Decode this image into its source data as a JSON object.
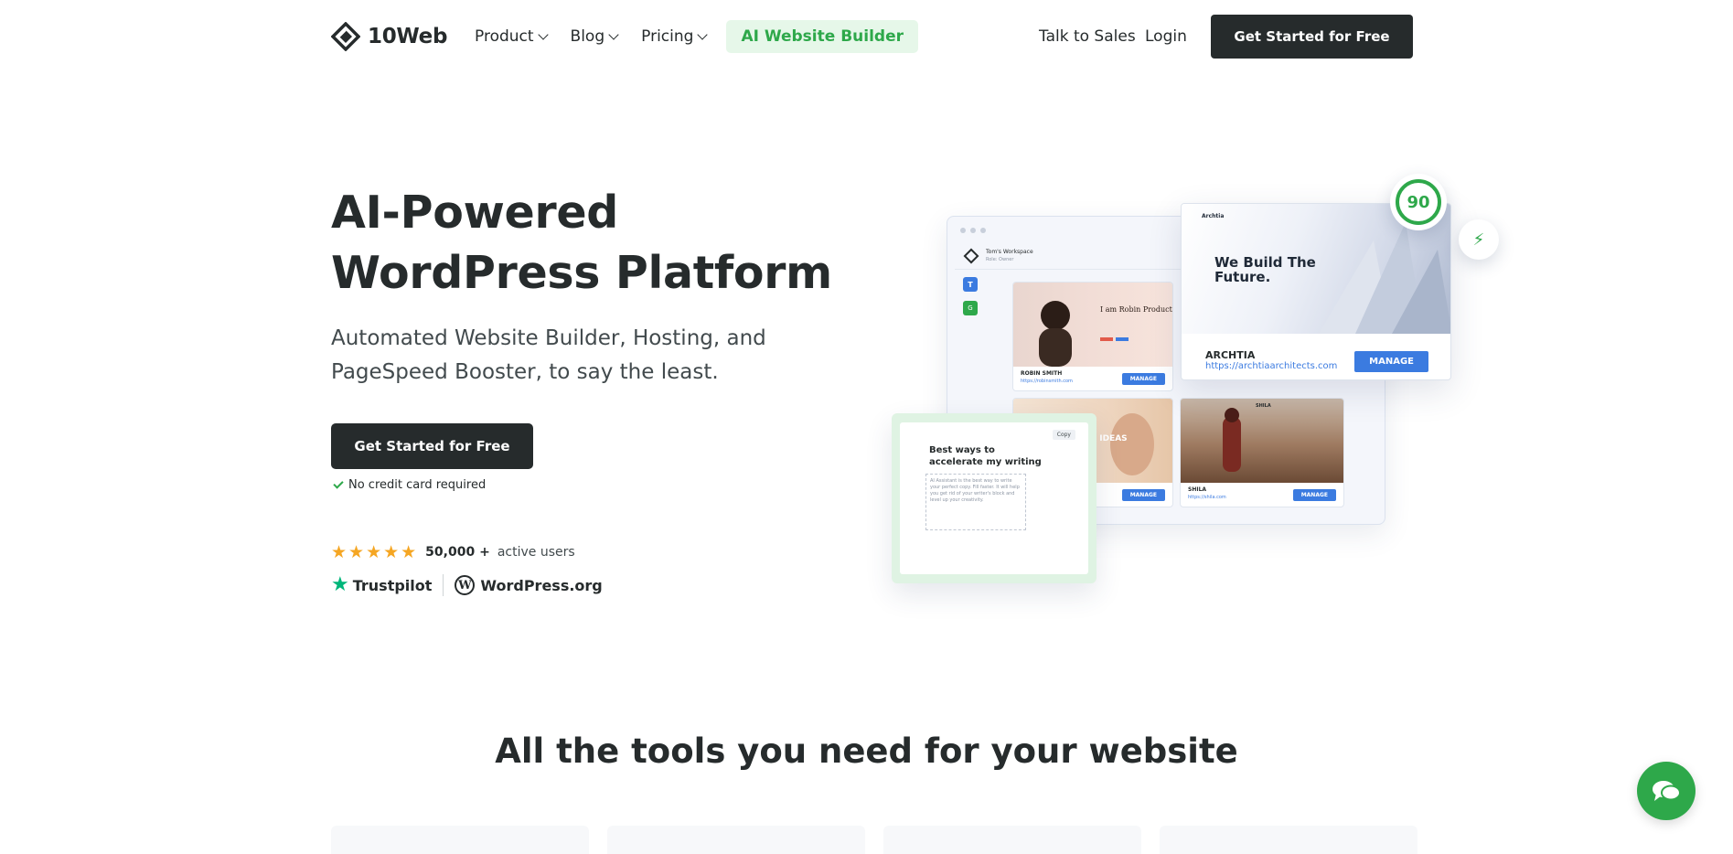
{
  "header": {
    "logo_text": "10Web",
    "nav": [
      {
        "label": "Product"
      },
      {
        "label": "Blog"
      },
      {
        "label": "Pricing"
      }
    ],
    "ai_builder": "AI Website Builder",
    "talk_to_sales": "Talk to Sales",
    "login": "Login",
    "cta": "Get Started for Free"
  },
  "hero": {
    "title": "AI-Powered WordPress Platform",
    "subtitle": "Automated Website Builder, Hosting, and PageSpeed Booster, to say the least.",
    "cta": "Get Started for Free",
    "no_credit": "No credit card required",
    "stars": "★★★★★",
    "users_count": "50,000 +",
    "users_label": "active users",
    "trustpilot": "Trustpilot",
    "wordpress": "WordPress.org"
  },
  "illustration": {
    "workspace_name": "Tom's Workspace",
    "workspace_sub": "Role: Owner",
    "side_t": "T",
    "side_g": "G",
    "card1": {
      "name": "ROBIN SMITH",
      "url": "https://robinsmith.com",
      "manage": "MANAGE",
      "headline": "I am Robin Product Designer"
    },
    "card2": {
      "name": "",
      "url": "",
      "manage": "MANAGE",
      "headline": "VE IDEAS"
    },
    "card3": {
      "name": "SHILA",
      "url": "https://shila.com",
      "manage": "MANAGE",
      "brand": "SHILA"
    },
    "arch": {
      "brand": "Archtia",
      "headline": "We Build The Future.",
      "name": "ARCHTIA",
      "url": "https://archtiaarchitects.com",
      "manage": "MANAGE"
    },
    "score": "90",
    "ai_card": {
      "copy": "Copy",
      "title": "Best ways to accelerate my writing",
      "body": "AI Assistant is the best way to write your perfect copy. Fill faster. It will help you get rid of your writer's block and level up your creativity."
    }
  },
  "section": {
    "title": "All the tools you need for your website"
  },
  "colors": {
    "dark": "#262b2c",
    "green": "#2ea84a",
    "blue": "#3b7be0",
    "star": "#f5a623"
  }
}
